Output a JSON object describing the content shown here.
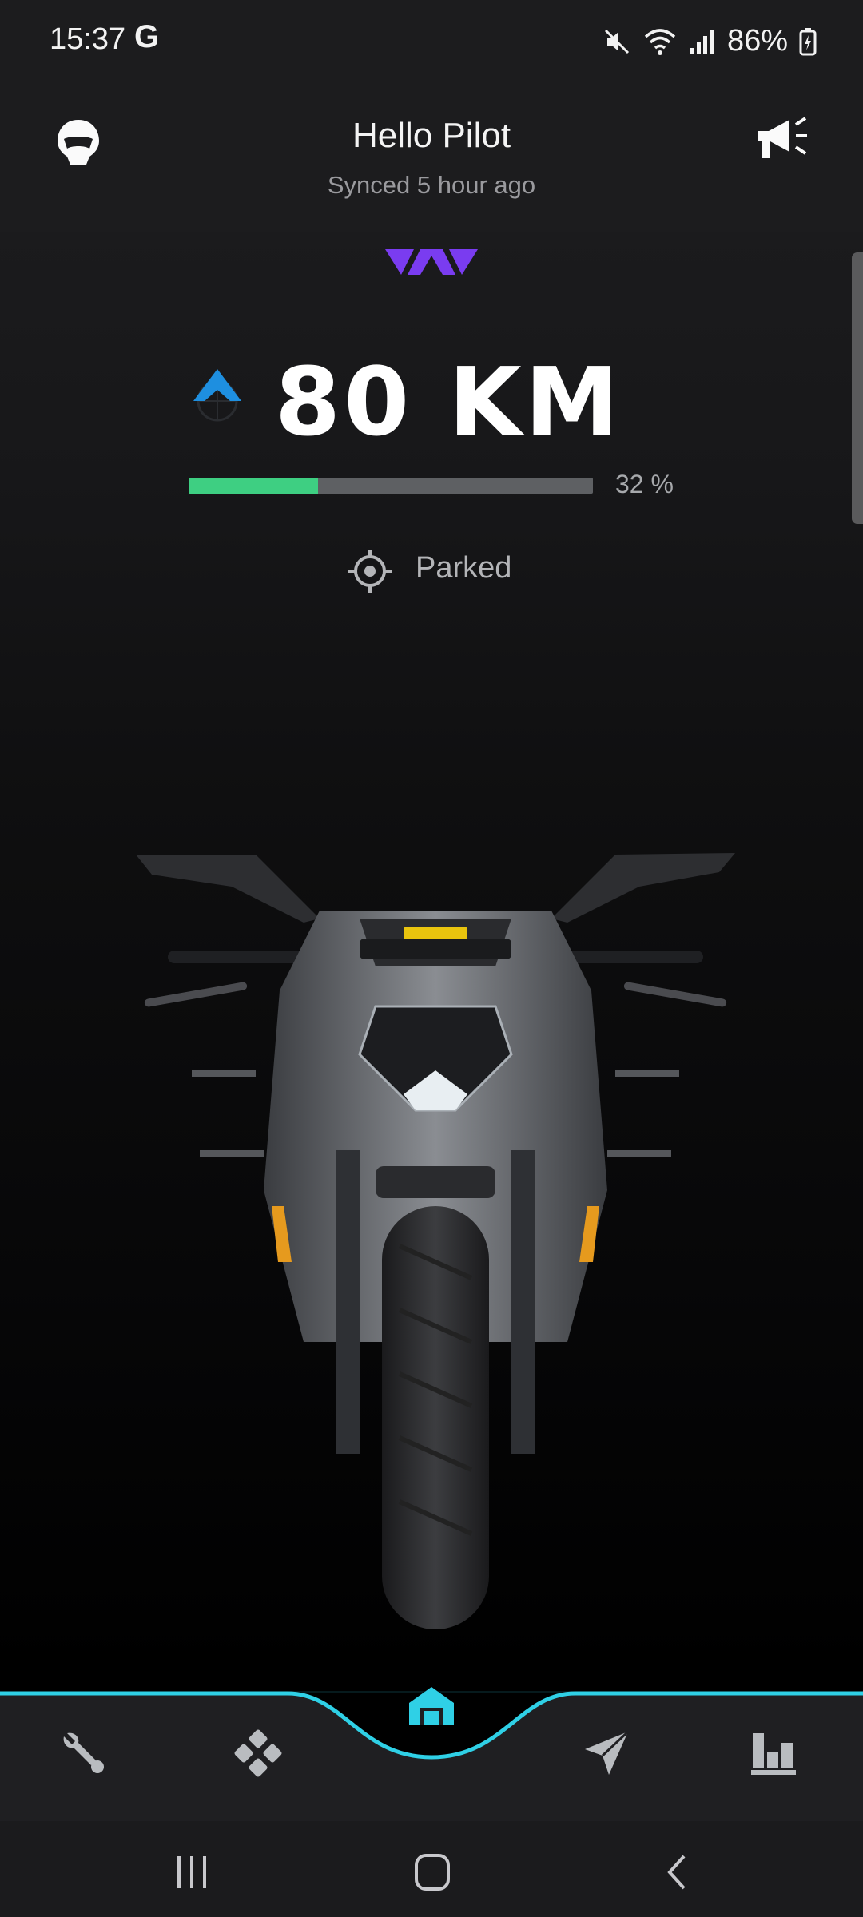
{
  "status_bar": {
    "time": "15:37",
    "carrier_icon": "google-g",
    "battery": "86%",
    "icons": [
      "mute-icon",
      "wifi-icon",
      "signal-icon",
      "battery-charging-icon"
    ]
  },
  "header": {
    "title": "Hello Pilot",
    "subtitle": "Synced 5 hour ago",
    "left_icon": "helmet-icon",
    "right_icon": "megaphone-icon"
  },
  "range": {
    "value_text": "80 KM",
    "battery_percent": 32,
    "battery_label": "32 %"
  },
  "state": {
    "label": "Parked"
  },
  "bottom_nav": {
    "items": [
      "service-icon",
      "gamepad-icon",
      "home-icon",
      "send-icon",
      "stats-icon"
    ],
    "active": "home-icon"
  },
  "system_nav": [
    "recents-button",
    "home-button",
    "back-button"
  ],
  "colors": {
    "accent": "#2fd0e6",
    "battery_fill": "#3ecf82",
    "brand": "#7a3cf0",
    "range_icon": "#1e8fe0"
  }
}
